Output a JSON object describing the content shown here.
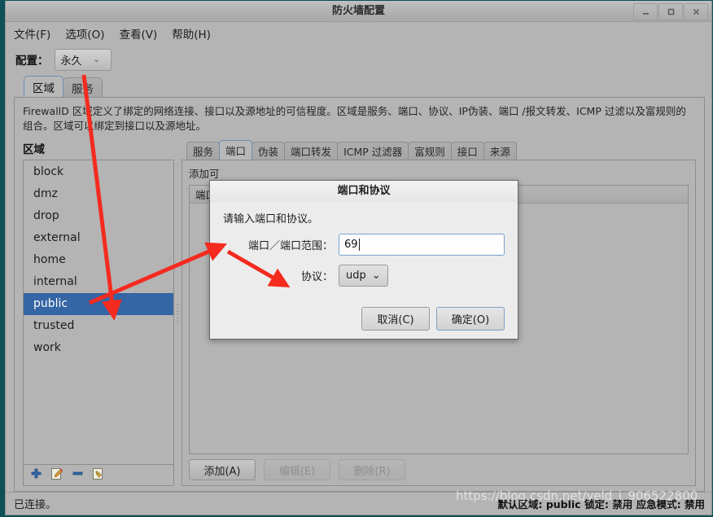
{
  "window": {
    "title": "防火墙配置",
    "controls": {
      "minimize": "_",
      "maximize": "❐",
      "close": "✕"
    }
  },
  "menubar": {
    "items": [
      {
        "label": "文件(F)"
      },
      {
        "label": "选项(O)"
      },
      {
        "label": "查看(V)"
      },
      {
        "label": "帮助(H)"
      }
    ]
  },
  "config": {
    "label": "配置：",
    "value": "永久",
    "caret": "⌄"
  },
  "main_tabs": [
    {
      "label": "区域",
      "active": true
    },
    {
      "label": "服务",
      "active": false
    }
  ],
  "description": "FirewallD 区域定义了绑定的网络连接、接口以及源地址的可信程度。区域是服务、端口、协议、IP伪装、端口 /报文转发、ICMP 过滤以及富规则的组合。区域可以绑定到接口以及源地址。",
  "zones_pane": {
    "title": "区域",
    "items": [
      {
        "name": "block",
        "selected": false
      },
      {
        "name": "dmz",
        "selected": false
      },
      {
        "name": "drop",
        "selected": false
      },
      {
        "name": "external",
        "selected": false
      },
      {
        "name": "home",
        "selected": false
      },
      {
        "name": "internal",
        "selected": false
      },
      {
        "name": "public",
        "selected": true
      },
      {
        "name": "trusted",
        "selected": false
      },
      {
        "name": "work",
        "selected": false
      }
    ],
    "toolbar": [
      {
        "icon": "add-zone-icon",
        "glyph": "✚"
      },
      {
        "icon": "edit-zone-icon",
        "glyph": "✎"
      },
      {
        "icon": "remove-zone-icon",
        "glyph": "━"
      },
      {
        "icon": "load-defaults-icon",
        "glyph": "⇲"
      }
    ]
  },
  "inner_tabs": [
    {
      "label": "服务",
      "active": false
    },
    {
      "label": "端口",
      "active": true
    },
    {
      "label": "伪装",
      "active": false
    },
    {
      "label": "端口转发",
      "active": false
    },
    {
      "label": "ICMP 过滤器",
      "active": false
    },
    {
      "label": "富规则",
      "active": false
    },
    {
      "label": "接口",
      "active": false
    },
    {
      "label": "来源",
      "active": false
    }
  ],
  "ports_panel": {
    "note": "添加可",
    "columns": [
      {
        "label": "端口"
      },
      {
        "label": ""
      }
    ],
    "rows": [],
    "buttons": [
      {
        "label": "添加(A)",
        "enabled": true
      },
      {
        "label": "编辑(E)",
        "enabled": false
      },
      {
        "label": "删除(R)",
        "enabled": false
      }
    ]
  },
  "statusbar": {
    "left": "已连接。",
    "right": "默认区域: public  锁定: 禁用  应急模式: 禁用"
  },
  "dialog": {
    "title": "端口和协议",
    "prompt": "请输入端口和协议。",
    "port_label": "端口／端口范围：",
    "port_value": "69",
    "protocol_label": "协议：",
    "protocol_value": "udp",
    "protocol_caret": "⌄",
    "cancel_label": "取消(C)",
    "ok_label": "确定(O)"
  },
  "watermark": {
    "text": "https://blog.csdn.net/yeld_i_906522800"
  },
  "colors": {
    "selection_blue": "#3465a4",
    "annotation_red": "#f42b1e",
    "window_bg": "#b4b4b4",
    "dialog_bg": "#ececec",
    "desktop": "#0d5055"
  }
}
